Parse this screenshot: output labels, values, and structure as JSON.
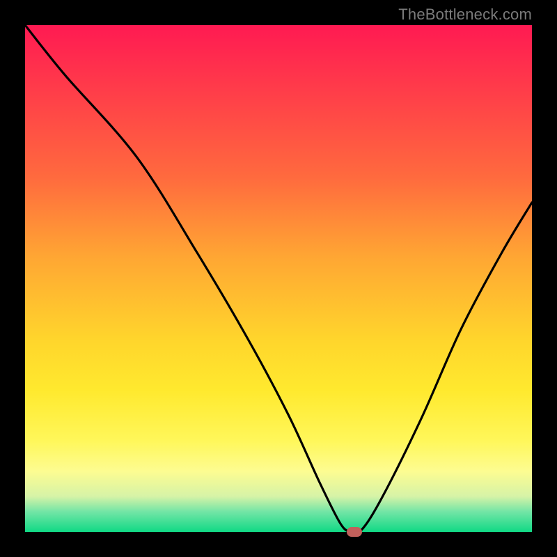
{
  "watermark": "TheBottleneck.com",
  "chart_data": {
    "type": "line",
    "title": "",
    "xlabel": "",
    "ylabel": "",
    "xlim": [
      0,
      100
    ],
    "ylim": [
      0,
      100
    ],
    "series": [
      {
        "name": "curve",
        "x": [
          0,
          8,
          22,
          34,
          44,
          52,
          58,
          62,
          64,
          66,
          70,
          78,
          86,
          94,
          100
        ],
        "values": [
          100,
          90,
          74,
          55,
          38,
          23,
          10,
          2,
          0,
          0,
          6,
          22,
          40,
          55,
          65
        ]
      }
    ],
    "marker": {
      "x": 65,
      "y": 0
    },
    "colors": {
      "curve": "#000000",
      "marker": "#c1605b",
      "gradient_top": "#ff1a52",
      "gradient_bottom": "#10d985"
    }
  }
}
